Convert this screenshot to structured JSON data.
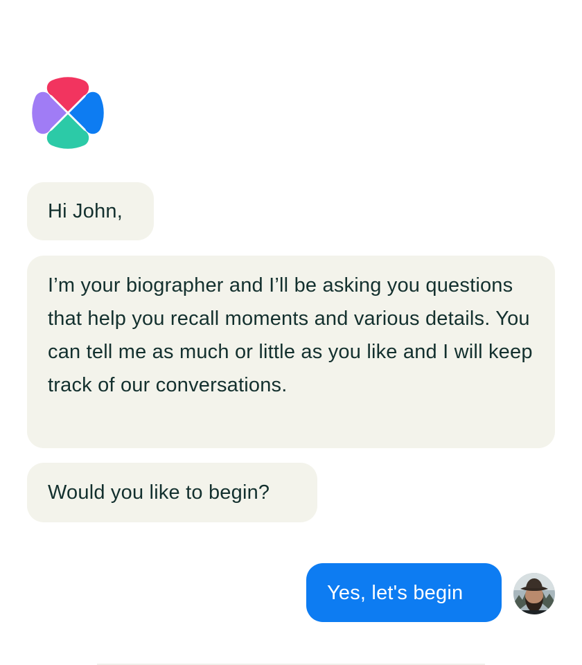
{
  "app": {
    "logo_icon": "biographer-logo-icon",
    "colors": {
      "red": "#f2345f",
      "purple": "#a07cf5",
      "blue": "#0d7cf2",
      "teal": "#2ccaa7"
    }
  },
  "conversation": {
    "bot_messages": [
      {
        "text": "Hi John,"
      },
      {
        "text": "I’m your biographer and I’ll be asking you questions that help you recall moments and various details. You can tell me as much or little as you like and I will keep track of our conversations."
      },
      {
        "text": "Would you like to begin?"
      }
    ],
    "user_messages": [
      {
        "text": "Yes, let's begin",
        "avatar_icon": "user-avatar-icon"
      }
    ],
    "colors": {
      "bot_bubble": "#f3f3eb",
      "bot_text": "#13302e",
      "user_bubble": "#0d7cf2",
      "user_text": "#ffffff"
    }
  }
}
